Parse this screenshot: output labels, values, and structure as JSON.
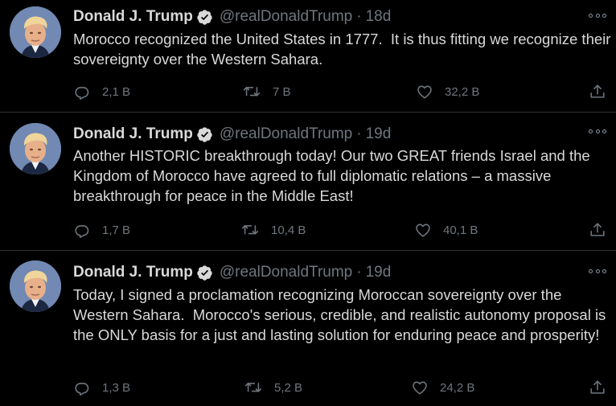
{
  "colors": {
    "background": "#000000",
    "text": "#d9d9d9",
    "secondary": "#6e767d",
    "divider": "#2f3336",
    "verified": "#d9d9d9"
  },
  "tweets": [
    {
      "name": "Donald J. Trump",
      "handle": "@realDonaldTrump",
      "separator": "·",
      "time": "18d",
      "text": "Morocco recognized the United States in 1777.  It is thus fitting we recognize their sovereignty over the Western Sahara.",
      "replies": "2,1 B",
      "retweets": "7 B",
      "likes": "32,2 B"
    },
    {
      "name": "Donald J. Trump",
      "handle": "@realDonaldTrump",
      "separator": "·",
      "time": "19d",
      "text": "Another HISTORIC breakthrough today! Our two GREAT friends Israel and the Kingdom of Morocco have agreed to full diplomatic relations – a massive breakthrough for peace in the Middle East!",
      "replies": "1,7 B",
      "retweets": "10,4 B",
      "likes": "40,1 B"
    },
    {
      "name": "Donald J. Trump",
      "handle": "@realDonaldTrump",
      "separator": "·",
      "time": "19d",
      "text": "Today, I signed a proclamation recognizing Moroccan sovereignty over the Western Sahara.  Morocco's serious, credible, and realistic autonomy proposal is the ONLY basis for a just and lasting solution for enduring peace and prosperity!",
      "replies": "1,3 B",
      "retweets": "5,2 B",
      "likes": "24,2 B"
    }
  ],
  "icons": {
    "avatar": "avatar",
    "verified": "verified-badge-icon",
    "more": "more-options-icon",
    "reply": "reply-icon",
    "retweet": "retweet-icon",
    "like": "like-icon",
    "share": "share-icon"
  }
}
